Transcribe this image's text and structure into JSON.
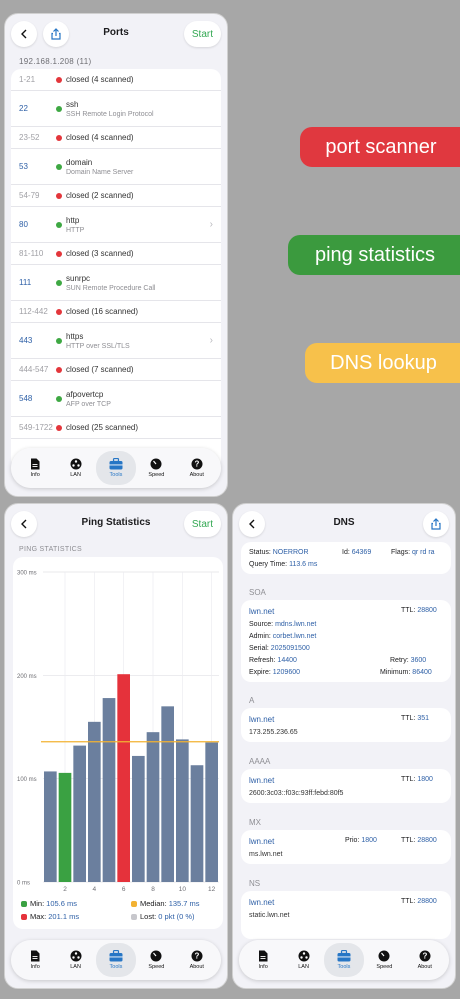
{
  "banners": [
    {
      "label": "port scanner",
      "color": "#e0383f"
    },
    {
      "label": "ping statistics",
      "color": "#3b9a3e"
    },
    {
      "label": "DNS lookup",
      "color": "#f7c14b"
    }
  ],
  "tabs": [
    "Info",
    "LAN",
    "Tools",
    "Speed",
    "About"
  ],
  "ports": {
    "title": "Ports",
    "start_label": "Start",
    "host": "192.168.1.208 (11)",
    "rows": [
      {
        "port": "1-21",
        "status": "closed (4 scanned)",
        "type": "closed"
      },
      {
        "port": "22",
        "name": "ssh",
        "desc": "SSH Remote Login Protocol",
        "type": "open"
      },
      {
        "port": "23-52",
        "status": "closed (4 scanned)",
        "type": "closed"
      },
      {
        "port": "53",
        "name": "domain",
        "desc": "Domain Name Server",
        "type": "open"
      },
      {
        "port": "54-79",
        "status": "closed (2 scanned)",
        "type": "closed"
      },
      {
        "port": "80",
        "name": "http",
        "desc": "HTTP",
        "type": "open",
        "chevron": true
      },
      {
        "port": "81-110",
        "status": "closed (3 scanned)",
        "type": "closed"
      },
      {
        "port": "111",
        "name": "sunrpc",
        "desc": "SUN Remote Procedure Call",
        "type": "open"
      },
      {
        "port": "112-442",
        "status": "closed (16 scanned)",
        "type": "closed"
      },
      {
        "port": "443",
        "name": "https",
        "desc": "HTTP over SSL/TLS",
        "type": "open",
        "chevron": true
      },
      {
        "port": "444-547",
        "status": "closed (7 scanned)",
        "type": "closed"
      },
      {
        "port": "548",
        "name": "afpovertcp",
        "desc": "AFP over TCP",
        "type": "open"
      },
      {
        "port": "549-1722",
        "status": "closed (25 scanned)",
        "type": "closed"
      }
    ]
  },
  "ping": {
    "title": "Ping Statistics",
    "start_label": "Start",
    "section": "PING STATISTICS",
    "stats": {
      "min_label": "Min:",
      "min": "105.6 ms",
      "median_label": "Median:",
      "median": "135.7 ms",
      "max_label": "Max:",
      "max": "201.1 ms",
      "lost_label": "Lost:",
      "lost": "0 pkt (0 %)"
    }
  },
  "chart_data": {
    "type": "bar",
    "categories": [
      "1",
      "2",
      "3",
      "4",
      "5",
      "6",
      "7",
      "8",
      "9",
      "10",
      "11",
      "12"
    ],
    "values": [
      107,
      105.6,
      132,
      155,
      178,
      201.1,
      122,
      145,
      170,
      138,
      113,
      135
    ],
    "bar_colors": [
      "#6b7f9e",
      "#3aa142",
      "#6b7f9e",
      "#6b7f9e",
      "#6b7f9e",
      "#e5323b",
      "#6b7f9e",
      "#6b7f9e",
      "#6b7f9e",
      "#6b7f9e",
      "#6b7f9e",
      "#6b7f9e"
    ],
    "median_line": 135.7,
    "median_color": "#f2b233",
    "ylim": [
      0,
      300
    ],
    "yticks": [
      {
        "v": 0,
        "label": "0 ms"
      },
      {
        "v": 100,
        "label": "100 ms"
      },
      {
        "v": 200,
        "label": "200 ms"
      },
      {
        "v": 300,
        "label": "300 ms"
      }
    ],
    "xtick_labels": [
      "2",
      "4",
      "6",
      "8",
      "10",
      "12"
    ],
    "grid": true
  },
  "dns": {
    "title": "DNS",
    "status_label": "Status:",
    "status": "NOERROR",
    "id_label": "Id:",
    "id": "64369",
    "flags_label": "Flags:",
    "flags": "qr rd ra",
    "query_time_label": "Query Time:",
    "query_time": "113.6 ms",
    "soa": {
      "section": "SOA",
      "host": "lwn.net",
      "ttl_label": "TTL:",
      "ttl": "28800",
      "source_label": "Source:",
      "source": "mdns.lwn.net",
      "admin_label": "Admin:",
      "admin": "corbet.lwn.net",
      "serial_label": "Serial:",
      "serial": "2025091500",
      "refresh_label": "Refresh:",
      "refresh": "14400",
      "retry_label": "Retry:",
      "retry": "3600",
      "expire_label": "Expire:",
      "expire": "1209600",
      "minimum_label": "Minimum:",
      "minimum": "86400"
    },
    "a": {
      "section": "A",
      "host": "lwn.net",
      "ttl_label": "TTL:",
      "ttl": "351",
      "value": "173.255.236.65"
    },
    "aaaa": {
      "section": "AAAA",
      "host": "lwn.net",
      "ttl_label": "TTL:",
      "ttl": "1800",
      "value": "2600:3c03::f03c:93ff:febd:80f5"
    },
    "mx": {
      "section": "MX",
      "host": "lwn.net",
      "prio_label": "Prio:",
      "prio": "1800",
      "ttl_label": "TTL:",
      "ttl": "28800",
      "value": "ms.lwn.net"
    },
    "ns": {
      "section": "NS",
      "host": "lwn.net",
      "ttl_label": "TTL:",
      "ttl": "28800",
      "value": "static.lwn.net"
    }
  }
}
